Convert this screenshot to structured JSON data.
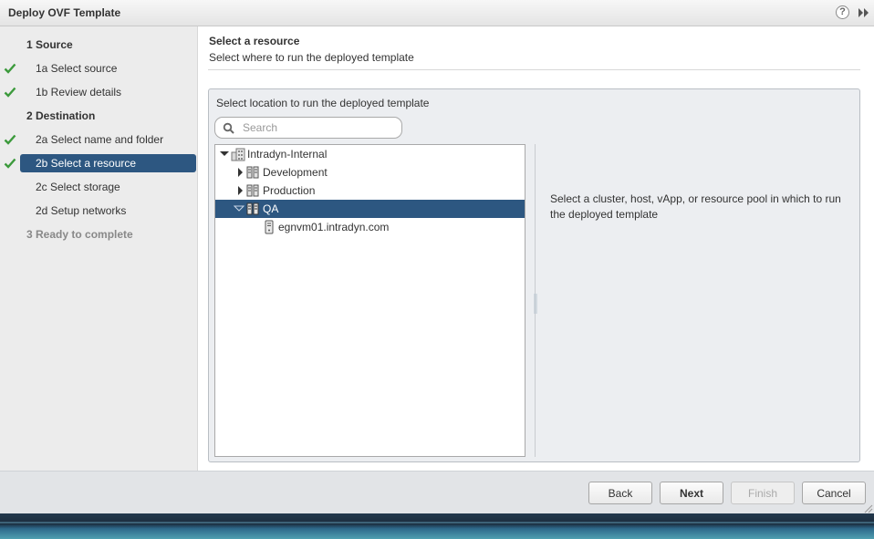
{
  "window": {
    "title": "Deploy OVF Template"
  },
  "colors": {
    "selection": "#2d5781",
    "check": "#3c9a3c",
    "panel_bg": "#eceef1"
  },
  "steps": [
    {
      "label": "1  Source",
      "type": "header",
      "checked": false
    },
    {
      "label": "1a  Select source",
      "type": "sub",
      "checked": true
    },
    {
      "label": "1b  Review details",
      "type": "sub",
      "checked": true
    },
    {
      "label": "2  Destination",
      "type": "header",
      "checked": false
    },
    {
      "label": "2a  Select name and folder",
      "type": "sub",
      "checked": true
    },
    {
      "label": "2b  Select a resource",
      "type": "sub",
      "checked": true,
      "active": true
    },
    {
      "label": "2c  Select storage",
      "type": "sub",
      "checked": false
    },
    {
      "label": "2d  Setup networks",
      "type": "sub",
      "checked": false
    },
    {
      "label": "3  Ready to complete",
      "type": "disabled",
      "checked": false
    }
  ],
  "main": {
    "heading": "Select a resource",
    "subheading": "Select where to run the deployed template",
    "panel_label": "Select location to run the deployed template",
    "search_placeholder": "Search",
    "description": "Select a cluster, host, vApp, or resource pool in which to run the deployed template"
  },
  "tree": [
    {
      "label": "Intradyn-Internal",
      "icon": "datacenter-icon",
      "expanded": true,
      "selected": false
    },
    {
      "label": "Development",
      "icon": "cluster-icon",
      "expanded": false,
      "selected": false
    },
    {
      "label": "Production",
      "icon": "cluster-icon",
      "expanded": false,
      "selected": false
    },
    {
      "label": "QA",
      "icon": "cluster-icon",
      "expanded": true,
      "selected": true
    },
    {
      "label": "egnvm01.intradyn.com",
      "icon": "host-icon",
      "expanded": null,
      "selected": false
    }
  ],
  "buttons": {
    "back": "Back",
    "next": "Next",
    "finish": "Finish",
    "cancel": "Cancel"
  },
  "icons": {
    "help": "?",
    "collapse": "double-chevron-right-icon",
    "check": "checkmark-icon",
    "search": "search-icon",
    "expand_closed": "triangle-right-icon",
    "expand_open": "triangle-down-icon"
  }
}
